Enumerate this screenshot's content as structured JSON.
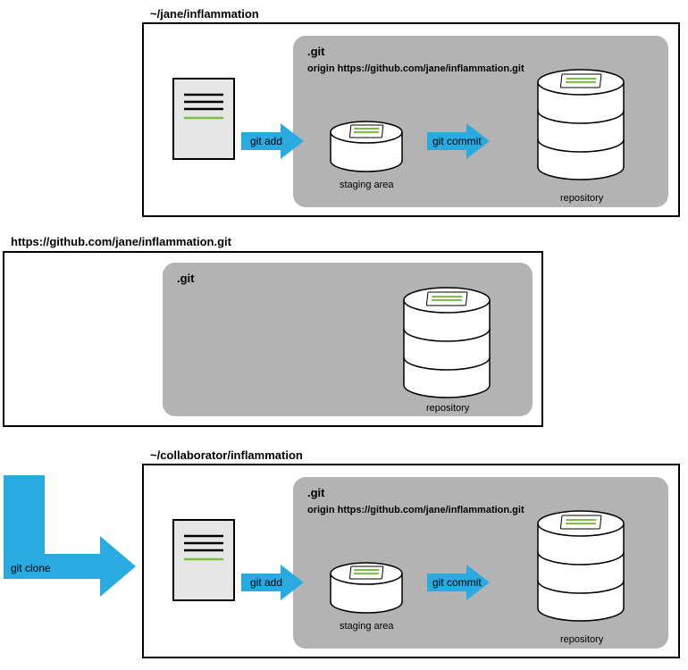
{
  "panel1": {
    "path": "~/jane/inflammation",
    "git_label": ".git",
    "origin_label": "origin https://github.com/jane/inflammation.git",
    "add_label": "git add",
    "commit_label": "git commit",
    "staging_label": "staging area",
    "repo_label": "repository"
  },
  "panel2": {
    "url": "https://github.com/jane/inflammation.git",
    "git_label": ".git",
    "repo_label": "repository"
  },
  "panel3": {
    "path": "~/collaborator/inflammation",
    "clone_label": "git clone",
    "git_label": ".git",
    "origin_label": "origin https://github.com/jane/inflammation.git",
    "add_label": "git add",
    "commit_label": "git commit",
    "staging_label": "staging area",
    "repo_label": "repository"
  }
}
